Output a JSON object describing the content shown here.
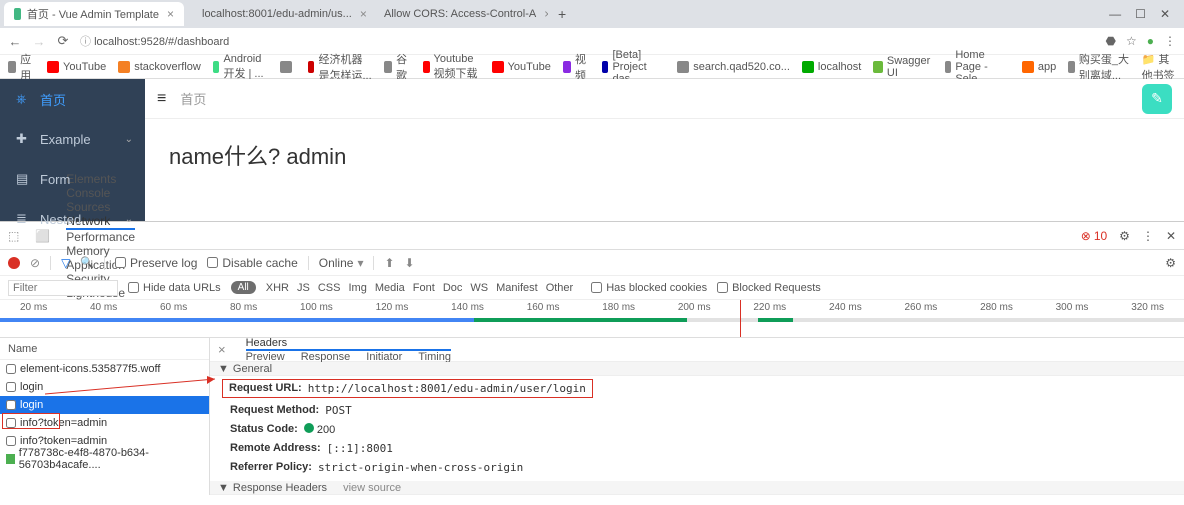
{
  "browser": {
    "tabs": [
      {
        "title": "首页 - Vue Admin Template",
        "active": true
      },
      {
        "title": "localhost:8001/edu-admin/us...",
        "active": false
      },
      {
        "title": "Allow CORS: Access-Control-A",
        "active": false
      }
    ],
    "url_prefix": "ⓘ ",
    "url": "localhost:9528/#/dashboard",
    "win": {
      "min": "—",
      "max": "☐",
      "close": "✕"
    },
    "addr_icons": {
      "back": "←",
      "fwd": "→",
      "reload": "⟳"
    },
    "addr_right": {
      "ext": "⬣",
      "star": "☆",
      "user": "●",
      "menu": "⋮"
    },
    "bookmarks": [
      {
        "label": "应用",
        "c": "#888"
      },
      {
        "label": "YouTube",
        "c": "#f00"
      },
      {
        "label": "stackoverflow",
        "c": "#f48024"
      },
      {
        "label": "Android 开发 | ...",
        "c": "#3ddc84"
      },
      {
        "label": "",
        "c": "#888"
      },
      {
        "label": "经济机器是怎样运...",
        "c": "#c00"
      },
      {
        "label": "谷歌",
        "c": "#888"
      },
      {
        "label": "Youtube视频下载",
        "c": "#f00"
      },
      {
        "label": "YouTube",
        "c": "#f00"
      },
      {
        "label": "视频",
        "c": "#8a2be2"
      },
      {
        "label": "[Beta] Project das...",
        "c": "#00a"
      },
      {
        "label": "search.qad520.co...",
        "c": "#888"
      },
      {
        "label": "localhost",
        "c": "#0a0"
      },
      {
        "label": "Swagger UI",
        "c": "#6bba3c"
      },
      {
        "label": "Home Page - Sele...",
        "c": "#888"
      },
      {
        "label": "app",
        "c": "#f60"
      },
      {
        "label": "购买蛋_大别离域...",
        "c": "#888"
      }
    ],
    "bk_overflow": "其他书签"
  },
  "app": {
    "sidebar": [
      {
        "icon": "⎈",
        "label": "首页",
        "active": true,
        "chev": false
      },
      {
        "icon": "✚",
        "label": "Example",
        "active": false,
        "chev": true
      },
      {
        "icon": "▤",
        "label": "Form",
        "active": false,
        "chev": false
      },
      {
        "icon": "≣",
        "label": "Nested",
        "active": false,
        "chev": true
      }
    ],
    "header": {
      "hamburger": "≡",
      "breadcrumb": "首页",
      "avatar": "✎"
    },
    "body_text": "name什么? admin"
  },
  "devtools": {
    "tabs": [
      "Elements",
      "Console",
      "Sources",
      "Network",
      "Performance",
      "Memory",
      "Application",
      "Security",
      "Lighthouse"
    ],
    "active_tab": "Network",
    "errors": "10",
    "gear": "⚙",
    "more": "⋮",
    "close": "✕",
    "toolbar": {
      "stop": "⊘",
      "filter": "▽",
      "search": "🔍",
      "preserve": "Preserve log",
      "disable": "Disable cache",
      "online": "Online",
      "upload": "⬆",
      "download": "⬇"
    },
    "filter": {
      "placeholder": "Filter",
      "hide": "Hide data URLs",
      "all": "All",
      "types": [
        "XHR",
        "JS",
        "CSS",
        "Img",
        "Media",
        "Font",
        "Doc",
        "WS",
        "Manifest",
        "Other"
      ],
      "blocked_cookies": "Has blocked cookies",
      "blocked_req": "Blocked Requests"
    },
    "timeline_ticks": [
      "20 ms",
      "40 ms",
      "60 ms",
      "80 ms",
      "100 ms",
      "120 ms",
      "140 ms",
      "160 ms",
      "180 ms",
      "200 ms",
      "220 ms",
      "240 ms",
      "260 ms",
      "280 ms",
      "300 ms",
      "320 ms"
    ],
    "req_header": "Name",
    "requests": [
      {
        "name": "element-icons.535877f5.woff",
        "sel": false
      },
      {
        "name": "login",
        "sel": false
      },
      {
        "name": "login",
        "sel": true
      },
      {
        "name": "info?token=admin",
        "sel": false
      },
      {
        "name": "info?token=admin",
        "sel": false
      },
      {
        "name": "f778738c-e4f8-4870-b634-56703b4acafe....",
        "sel": false
      }
    ],
    "detail_tabs": [
      "Headers",
      "Preview",
      "Response",
      "Initiator",
      "Timing"
    ],
    "detail_active": "Headers",
    "general_label": "General",
    "general": {
      "url_k": "Request URL:",
      "url_v": "http://localhost:8001/edu-admin/user/login",
      "method_k": "Request Method:",
      "method_v": "POST",
      "status_k": "Status Code:",
      "status_v": "200",
      "remote_k": "Remote Address:",
      "remote_v": "[::1]:8001",
      "referrer_k": "Referrer Policy:",
      "referrer_v": "strict-origin-when-cross-origin"
    },
    "resp_headers_label": "Response Headers",
    "view_source": "view source"
  },
  "watermark": ""
}
